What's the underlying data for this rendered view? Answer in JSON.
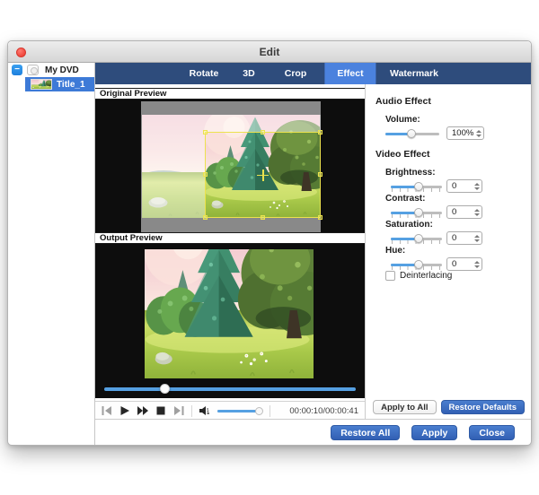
{
  "window": {
    "title": "Edit"
  },
  "sidebar": {
    "root_label": "My DVD",
    "expand_glyph": "−",
    "item_label": "Title_1"
  },
  "tabs": [
    {
      "label": "Rotate",
      "active": false
    },
    {
      "label": "3D",
      "active": false
    },
    {
      "label": "Crop",
      "active": false
    },
    {
      "label": "Effect",
      "active": true
    },
    {
      "label": "Watermark",
      "active": false
    }
  ],
  "previews": {
    "original_label": "Original Preview",
    "output_label": "Output Preview"
  },
  "transport": {
    "time": "00:00:10/00:00:41"
  },
  "audio_effect": {
    "section_label": "Audio Effect",
    "volume_label": "Volume:",
    "volume_value": "100%"
  },
  "video_effect": {
    "section_label": "Video Effect",
    "controls": [
      {
        "label": "Brightness:",
        "value": "0"
      },
      {
        "label": "Contrast:",
        "value": "0"
      },
      {
        "label": "Saturation:",
        "value": "0"
      },
      {
        "label": "Hue:",
        "value": "0"
      }
    ],
    "deinterlacing_label": "Deinterlacing"
  },
  "buttons": {
    "apply_to_all": "Apply to All",
    "restore_defaults": "Restore Defaults",
    "restore_all": "Restore All",
    "apply": "Apply",
    "close": "Close"
  },
  "colors": {
    "navy": "#2e4c7c",
    "tab_active": "#4b82de",
    "selection_blue": "#3d7ad7",
    "button_blue_light": "#4a7ecf",
    "button_blue_dark": "#3260b4",
    "slider_blue": "#55a0e2",
    "crop_yellow": "#ece24e"
  }
}
